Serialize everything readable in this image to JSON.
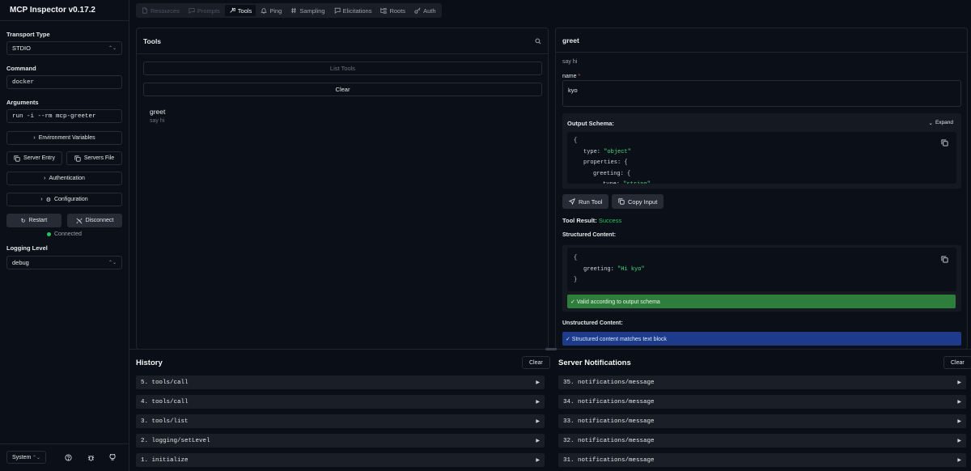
{
  "app": {
    "title": "MCP Inspector v0.17.2"
  },
  "sidebar": {
    "transport_label": "Transport Type",
    "transport_value": "STDIO",
    "command_label": "Command",
    "command_value": "docker",
    "arguments_label": "Arguments",
    "arguments_value": "run -i --rm mcp-greeter",
    "env_button": "Environment Variables",
    "server_entry_button": "Server Entry",
    "servers_file_button": "Servers File",
    "auth_button": "Authentication",
    "config_button": "Configuration",
    "restart_button": "Restart",
    "disconnect_button": "Disconnect",
    "status_text": "Connected",
    "status_color": "#22c55e",
    "logging_label": "Logging Level",
    "logging_value": "debug",
    "theme_value": "System"
  },
  "tabs": [
    {
      "label": "Resources",
      "icon": "resources-icon",
      "state": "disabled"
    },
    {
      "label": "Prompts",
      "icon": "prompts-icon",
      "state": "disabled"
    },
    {
      "label": "Tools",
      "icon": "tools-icon",
      "state": "active"
    },
    {
      "label": "Ping",
      "icon": "bell-icon",
      "state": "normal"
    },
    {
      "label": "Sampling",
      "icon": "hash-icon",
      "state": "normal"
    },
    {
      "label": "Elicitations",
      "icon": "message-icon",
      "state": "normal"
    },
    {
      "label": "Roots",
      "icon": "folder-tree-icon",
      "state": "normal"
    },
    {
      "label": "Auth",
      "icon": "key-icon",
      "state": "normal"
    }
  ],
  "tools_panel": {
    "title": "Tools",
    "list_button": "List Tools",
    "clear_button": "Clear",
    "items": [
      {
        "name": "greet",
        "description": "say hi"
      }
    ]
  },
  "tool_detail": {
    "title": "greet",
    "description": "say hi",
    "param_label": "name",
    "param_required": "*",
    "param_value": "kyo",
    "output_schema_label": "Output Schema:",
    "expand_label": "Expand",
    "schema_lines": [
      {
        "key": "{",
        "value": ""
      },
      {
        "key": "type:",
        "value": "\"object\""
      },
      {
        "key": "properties: {",
        "value": ""
      },
      {
        "key": "greeting: {",
        "value": ""
      },
      {
        "key": "type:",
        "value": "\"string\""
      }
    ],
    "run_button": "Run Tool",
    "copy_button": "Copy Input",
    "result_label": "Tool Result:",
    "result_status": "Success",
    "structured_label": "Structured Content:",
    "structured_lines": [
      {
        "key": "{",
        "value": ""
      },
      {
        "key": "greeting:",
        "value": "\"Hi kyo\""
      },
      {
        "key": "}",
        "value": ""
      }
    ],
    "valid_text": "✓ Valid according to output schema",
    "unstructured_label": "Unstructured Content:",
    "match_text": "✓ Structured content matches text block"
  },
  "history": {
    "title": "History",
    "clear_button": "Clear",
    "items": [
      "5. tools/call",
      "4. tools/call",
      "3. tools/list",
      "2. logging/setLevel",
      "1. initialize"
    ]
  },
  "notifications": {
    "title": "Server Notifications",
    "clear_button": "Clear",
    "items": [
      "35. notifications/message",
      "34. notifications/message",
      "33. notifications/message",
      "32. notifications/message",
      "31. notifications/message"
    ]
  }
}
